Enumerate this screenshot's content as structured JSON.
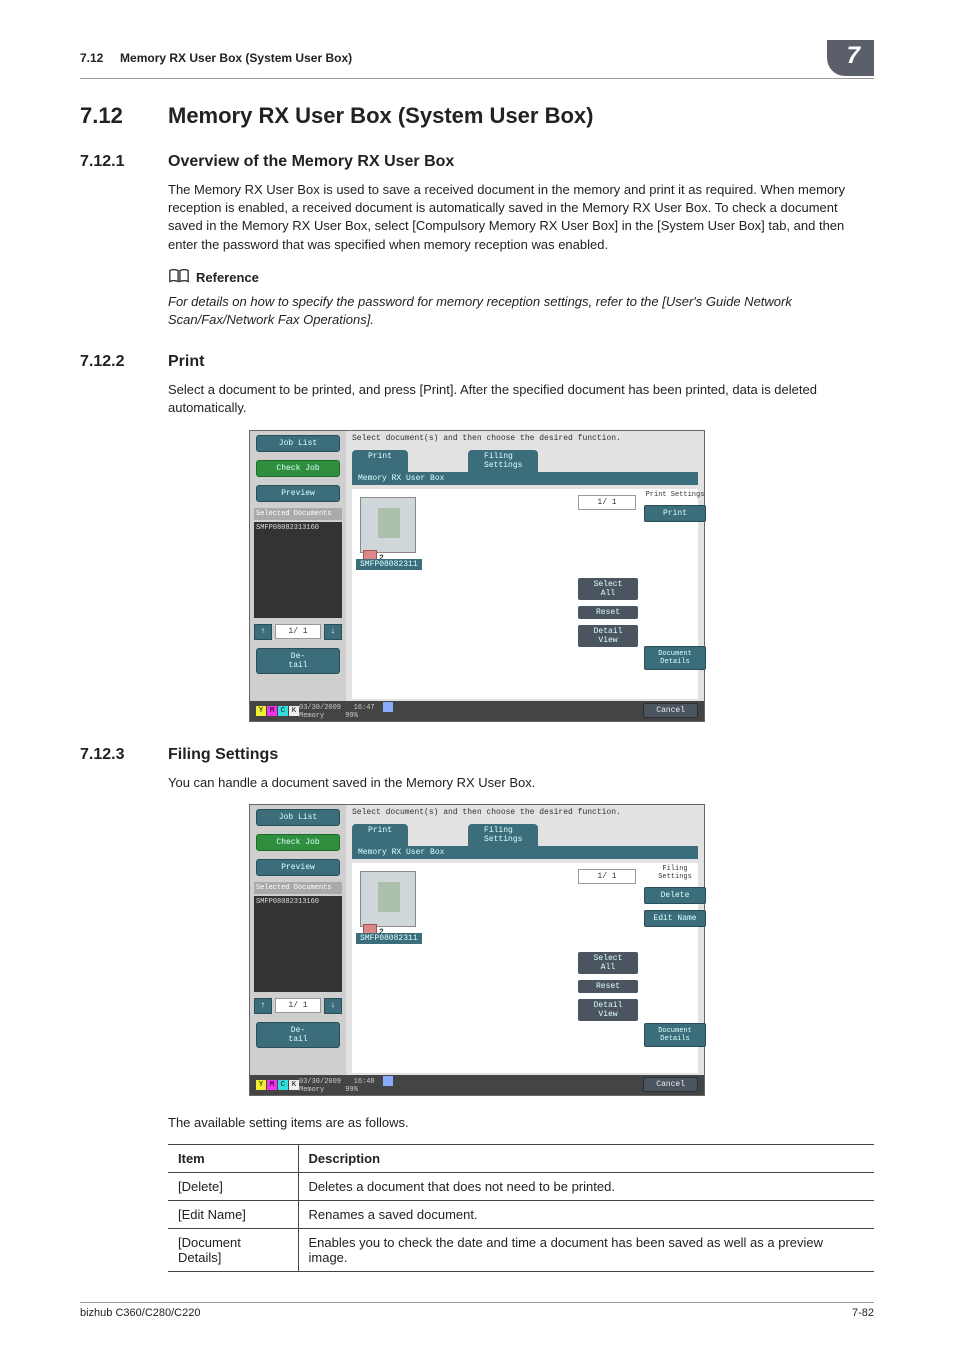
{
  "header": {
    "section_no": "7.12",
    "running_title": "Memory RX User Box (System User Box)",
    "chapter_badge": "7"
  },
  "h1": {
    "num": "7.12",
    "title": "Memory RX User Box (System User Box)"
  },
  "s1": {
    "num": "7.12.1",
    "title": "Overview of the Memory RX User Box",
    "para1": "The Memory RX User Box is used to save a received document in the memory and print it as required. When memory reception is enabled, a received document is automatically saved in the Memory RX User Box. To check a document saved in the Memory RX User Box, select [Compulsory Memory RX User Box] in the [System User Box] tab, and then enter the password that was specified when memory reception was enabled.",
    "ref_label": "Reference",
    "ref_text": "For details on how to specify the password for memory reception settings, refer to the [User's Guide Network Scan/Fax/Network Fax Operations]."
  },
  "s2": {
    "num": "7.12.2",
    "title": "Print",
    "para1": "Select a document to be printed, and press [Print]. After the specified document has been printed, data is deleted automatically."
  },
  "s3": {
    "num": "7.12.3",
    "title": "Filing Settings",
    "para1": "You can handle a document saved in the Memory RX User Box.",
    "para2": "The available setting items are as follows."
  },
  "shot_common": {
    "instruction": "Select document(s) and then choose the desired function.",
    "left": {
      "job_list": "Job List",
      "check_job": "Check Job",
      "preview": "Preview",
      "selected_docs": "Selected Documents",
      "doc_name": "SMFP08082313160",
      "pager": "1/ 1",
      "detail_btn": "De-\ntail"
    },
    "tabs": {
      "print": "Print",
      "filing": "Filing\nSettings"
    },
    "subtab": "Memory RX User Box",
    "thumb": {
      "num": "2",
      "label": "SMFP08082311"
    },
    "right": {
      "pager": "1/ 1",
      "select_all": "Select\nAll",
      "reset": "Reset",
      "detail_view": "Detail\nView",
      "doc_details": "Document\nDetails"
    },
    "bottom": {
      "cancel": "Cancel",
      "ymck": [
        "Y",
        "M",
        "C",
        "K"
      ]
    }
  },
  "shot1": {
    "right_head": "Print Settings",
    "right_btn1": "Print",
    "date": "03/30/2009",
    "time": "16:47",
    "mem_label": "Memory",
    "mem_pct": "99%"
  },
  "shot2": {
    "right_head": "Filing\nSettings",
    "right_btn1": "Delete",
    "right_btn2": "Edit Name",
    "date": "03/30/2009",
    "time": "16:48",
    "mem_label": "Memory",
    "mem_pct": "99%"
  },
  "table": {
    "head": {
      "c1": "Item",
      "c2": "Description"
    },
    "rows": [
      {
        "c1": "[Delete]",
        "c2": "Deletes a document that does not need to be printed."
      },
      {
        "c1": "[Edit Name]",
        "c2": "Renames a saved document."
      },
      {
        "c1": "[Document Details]",
        "c2": "Enables you to check the date and time a document has been saved as well as a preview image."
      }
    ]
  },
  "footer": {
    "left": "bizhub C360/C280/C220",
    "right": "7-82"
  }
}
